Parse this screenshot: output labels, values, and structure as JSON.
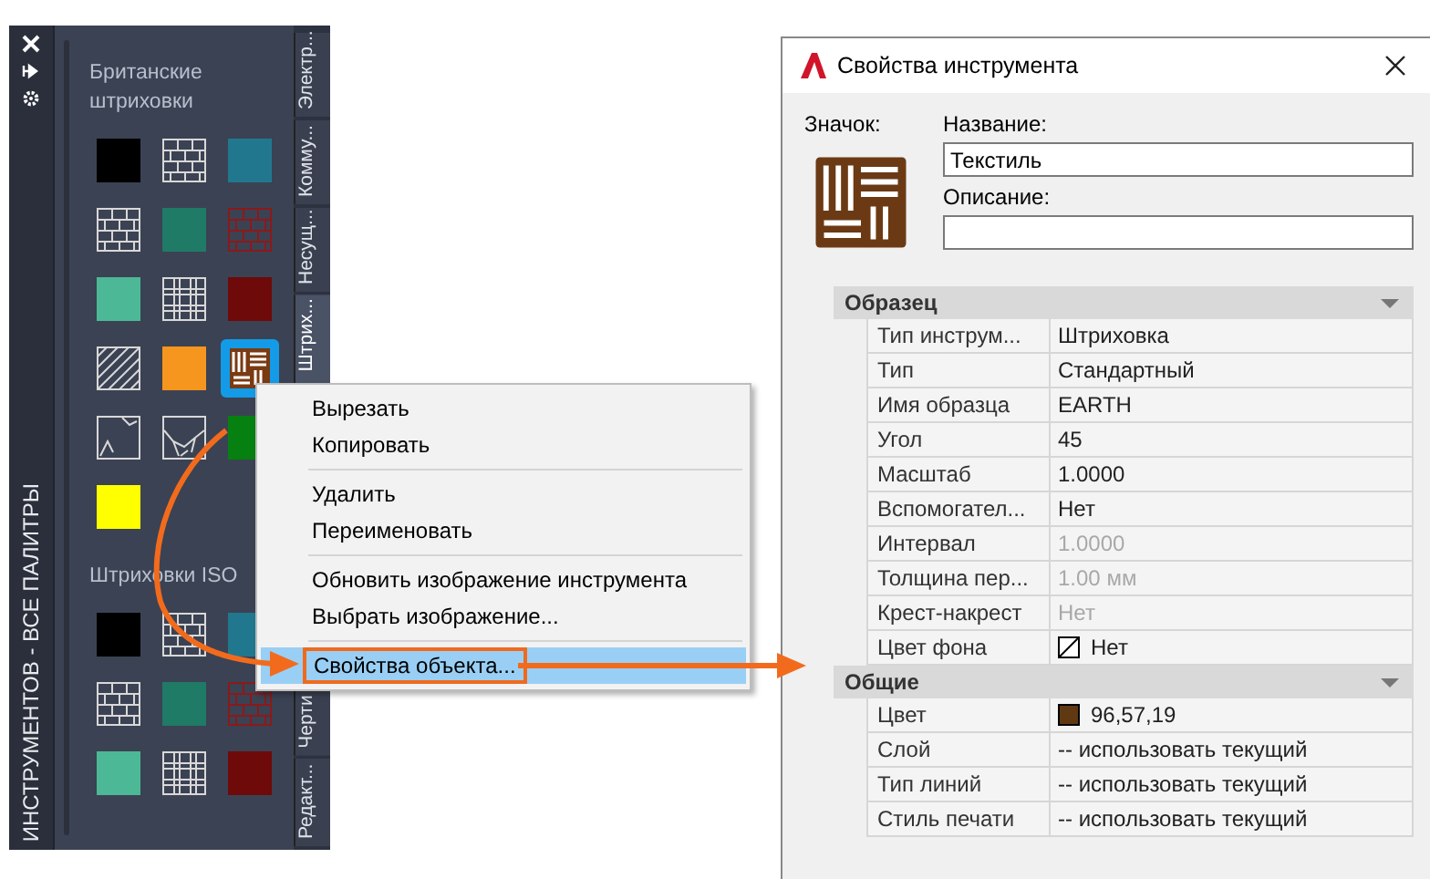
{
  "palette": {
    "side_title": "ИНСТРУМЕНТОВ - ВСЕ ПАЛИТРЫ",
    "tabs": [
      {
        "label": "Электр...",
        "selected": false
      },
      {
        "label": "Комму...",
        "selected": false
      },
      {
        "label": "Несущ...",
        "selected": false
      },
      {
        "label": "Штрих...",
        "selected": true
      },
      {
        "label": "Черти",
        "selected": false
      },
      {
        "label": "Редакт...",
        "selected": false
      }
    ],
    "groups": [
      {
        "title": "Британские штриховки",
        "items": [
          {
            "kind": "solid",
            "color": "#000000",
            "selected": false
          },
          {
            "kind": "brick",
            "color": "#d8d8d8",
            "selected": false
          },
          {
            "kind": "solid",
            "color": "#21788e",
            "selected": false
          },
          {
            "kind": "brick",
            "color": "#d8d8d8",
            "selected": false
          },
          {
            "kind": "solid",
            "color": "#1f7a66",
            "selected": false
          },
          {
            "kind": "brick",
            "color": "#8a1a1a",
            "selected": false
          },
          {
            "kind": "solid",
            "color": "#4cb896",
            "selected": false
          },
          {
            "kind": "grid",
            "color": "#d8d8d8",
            "selected": false
          },
          {
            "kind": "solid",
            "color": "#6e0a0a",
            "selected": false
          },
          {
            "kind": "diagonal",
            "color": "#d8d8d8",
            "selected": false
          },
          {
            "kind": "solid",
            "color": "#f7961e",
            "selected": false
          },
          {
            "kind": "parquet",
            "color": "#7a3a12",
            "selected": true
          },
          {
            "kind": "earth",
            "color": "#d8d8d8",
            "selected": false
          },
          {
            "kind": "rock",
            "color": "#d8d8d8",
            "selected": false
          },
          {
            "kind": "solid",
            "color": "#068010",
            "selected": false
          },
          {
            "kind": "solid",
            "color": "#ffff00",
            "selected": false
          }
        ]
      },
      {
        "title": "Штриховки ISO",
        "items": [
          {
            "kind": "solid",
            "color": "#000000",
            "selected": false
          },
          {
            "kind": "brick",
            "color": "#d8d8d8",
            "selected": false
          },
          {
            "kind": "solid",
            "color": "#21788e",
            "selected": false
          },
          {
            "kind": "brick",
            "color": "#d8d8d8",
            "selected": false
          },
          {
            "kind": "solid",
            "color": "#1f7a66",
            "selected": false
          },
          {
            "kind": "brick",
            "color": "#8a1a1a",
            "selected": false
          },
          {
            "kind": "solid",
            "color": "#4cb896",
            "selected": false
          },
          {
            "kind": "grid",
            "color": "#d8d8d8",
            "selected": false
          },
          {
            "kind": "solid",
            "color": "#6e0a0a",
            "selected": false
          }
        ]
      }
    ]
  },
  "context_menu": {
    "groups": [
      [
        {
          "label": "Вырезать",
          "selected": false
        },
        {
          "label": "Копировать",
          "selected": false
        }
      ],
      [
        {
          "label": "Удалить",
          "selected": false
        },
        {
          "label": "Переименовать",
          "selected": false
        }
      ],
      [
        {
          "label": "Обновить изображение инструмента",
          "selected": false
        },
        {
          "label": "Выбрать изображение...",
          "selected": false
        }
      ],
      [
        {
          "label": "Свойства объекта...",
          "selected": true
        }
      ]
    ]
  },
  "dialog": {
    "title": "Свойства инструмента",
    "icon_label": "Значок:",
    "name_label": "Название:",
    "name_value": "Текстиль",
    "description_label": "Описание:",
    "sections": [
      {
        "title": "Образец",
        "rows": [
          {
            "kind": "text",
            "label": "Тип  инструм...",
            "value": "Штриховка",
            "disabled": false
          },
          {
            "kind": "text",
            "label": "Тип",
            "value": "Стандартный",
            "disabled": false
          },
          {
            "kind": "text",
            "label": "Имя образца",
            "value": "EARTH",
            "disabled": false
          },
          {
            "kind": "text",
            "label": "Угол",
            "value": "45",
            "disabled": false
          },
          {
            "kind": "text",
            "label": "Масштаб",
            "value": "1.0000",
            "disabled": false
          },
          {
            "kind": "text",
            "label": "Вспомогател...",
            "value": "Нет",
            "disabled": false
          },
          {
            "kind": "text",
            "label": "Интервал",
            "value": "1.0000",
            "disabled": true
          },
          {
            "kind": "text",
            "label": "Толщина  пер...",
            "value": "1.00 мм",
            "disabled": true
          },
          {
            "kind": "text",
            "label": "Крест-накрест",
            "value": "Нет",
            "disabled": true
          },
          {
            "kind": "no-color",
            "label": "Цвет фона",
            "value": "Нет",
            "disabled": false
          }
        ]
      },
      {
        "title": "Общие",
        "rows": [
          {
            "kind": "color",
            "label": "Цвет",
            "value": "96,57,19",
            "color": "#603913",
            "disabled": false
          },
          {
            "kind": "text",
            "label": "Слой",
            "value": "-- использовать текущий",
            "disabled": false
          },
          {
            "kind": "text",
            "label": "Тип линий",
            "value": "-- использовать текущий",
            "disabled": false
          },
          {
            "kind": "text",
            "label": "Стиль печати",
            "value": "-- использовать текущий",
            "disabled": false
          }
        ]
      }
    ]
  }
}
